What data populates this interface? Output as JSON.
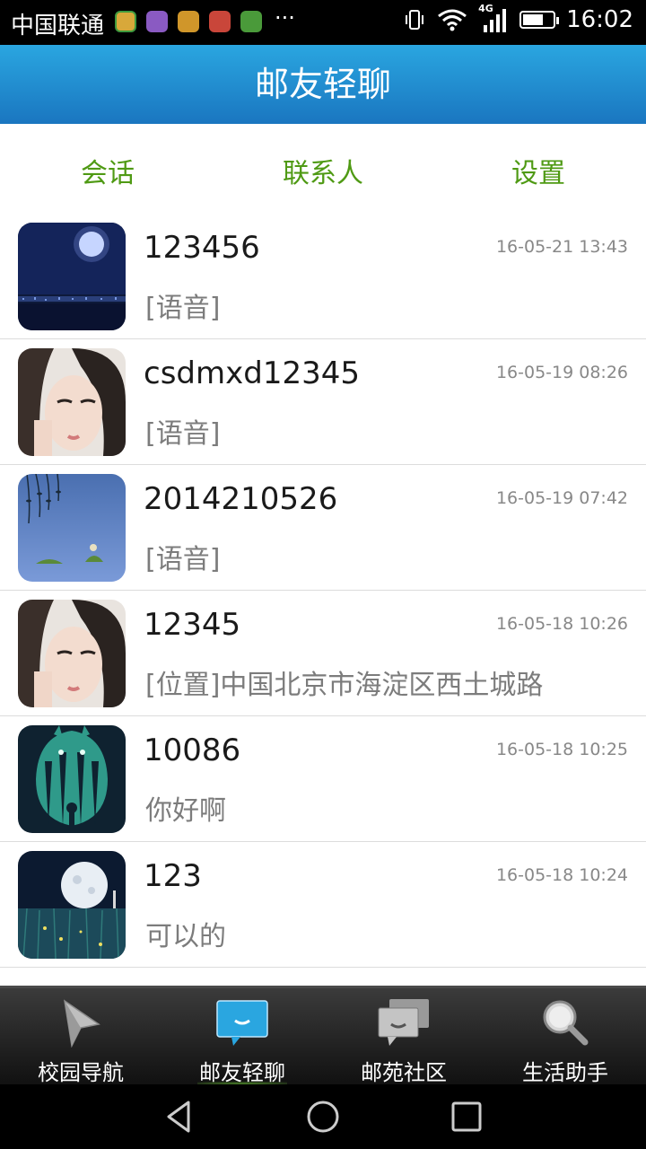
{
  "status_bar": {
    "carrier": "中国联通",
    "more": "···",
    "time": "16:02",
    "network": "4G",
    "battery_level": 0.7,
    "notification_icons": [
      "wechat-green-icon",
      "gallery-purple-icon",
      "hand-orange-icon",
      "tool-red-icon",
      "grid-green-icon"
    ]
  },
  "app": {
    "title": "邮友轻聊"
  },
  "tabs": [
    {
      "label": "会话"
    },
    {
      "label": "联系人"
    },
    {
      "label": "设置"
    }
  ],
  "conversations": [
    {
      "name": "123456",
      "message": "[语音]",
      "time": "16-05-21 13:43",
      "avatar": "moon-city-night"
    },
    {
      "name": "csdmxd12345",
      "message": "[语音]",
      "time": "16-05-19 08:26",
      "avatar": "girl-portrait"
    },
    {
      "name": "2014210526",
      "message": "[语音]",
      "time": "16-05-19 07:42",
      "avatar": "willow-lake"
    },
    {
      "name": "12345",
      "message": "[位置]中国北京市海淀区西土城路",
      "time": "16-05-18 10:26",
      "avatar": "girl-portrait"
    },
    {
      "name": "10086",
      "message": "你好啊",
      "time": "16-05-18 10:25",
      "avatar": "totoro-forest"
    },
    {
      "name": "123",
      "message": "可以的",
      "time": "16-05-18 10:24",
      "avatar": "moon-meadow"
    }
  ],
  "bottom_nav": [
    {
      "label": "校园导航",
      "icon": "navigation-arrow-icon"
    },
    {
      "label": "邮友轻聊",
      "icon": "chat-bubble-icon"
    },
    {
      "label": "邮苑社区",
      "icon": "community-chat-icon"
    },
    {
      "label": "生活助手",
      "icon": "magnifier-icon"
    }
  ],
  "active_nav": "邮友轻聊",
  "colors": {
    "title_bar": "#1f8fd2",
    "tab_text": "#4f9a14",
    "nav_active_icon": "#2aa6e0"
  }
}
